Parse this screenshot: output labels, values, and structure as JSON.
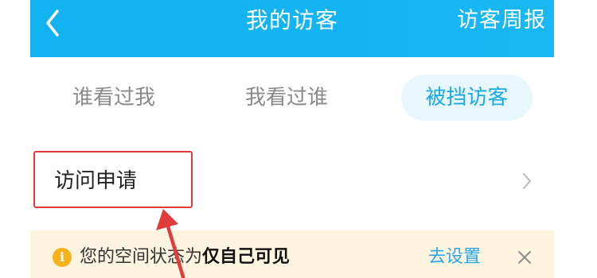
{
  "header": {
    "title": "我的访客",
    "action_label": "访客周报",
    "back_icon": "chevron-left-icon",
    "bg_color": "#14b4f3"
  },
  "tabs": [
    {
      "label": "谁看过我",
      "active": false
    },
    {
      "label": "我看过谁",
      "active": false
    },
    {
      "label": "被挡访客",
      "active": true
    }
  ],
  "row": {
    "label": "访问申请",
    "chevron_icon": "chevron-right-icon"
  },
  "notice": {
    "icon": "info-icon",
    "icon_glyph": "i",
    "text_prefix": "您的空间状态为",
    "text_strong": "仅自己可见",
    "link_label": "去设置",
    "close_icon": "close-icon",
    "bg_color": "#fcf4de"
  },
  "annotation": {
    "highlight_color": "#e03c3c"
  }
}
